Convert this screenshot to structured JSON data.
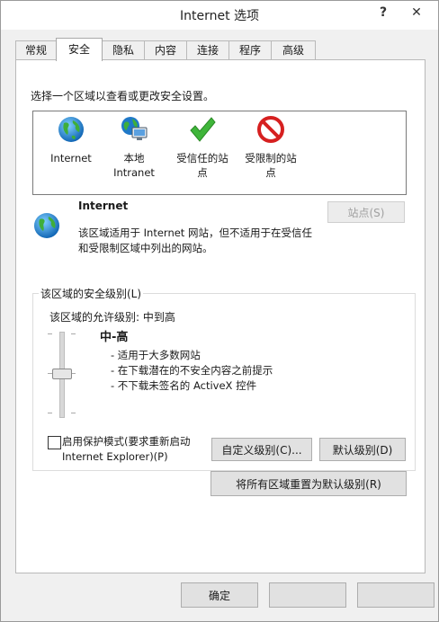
{
  "window": {
    "title": "Internet 选项",
    "help_glyph": "?",
    "close_glyph": "✕"
  },
  "tabs": [
    {
      "label": "常规"
    },
    {
      "label": "安全"
    },
    {
      "label": "隐私"
    },
    {
      "label": "内容"
    },
    {
      "label": "连接"
    },
    {
      "label": "程序"
    },
    {
      "label": "高级"
    }
  ],
  "security": {
    "select_prompt": "选择一个区域以查看或更改安全设置。",
    "zones": [
      {
        "label_line1": "Internet",
        "label_line2": "",
        "icon": "globe-icon"
      },
      {
        "label_line1": "本地",
        "label_line2": "Intranet",
        "icon": "intranet-icon"
      },
      {
        "label_line1": "受信任的站",
        "label_line2": "点",
        "icon": "check-icon"
      },
      {
        "label_line1": "受限制的站",
        "label_line2": "点",
        "icon": "restricted-icon"
      }
    ],
    "selected_zone": {
      "name": "Internet",
      "desc_line1": "该区域适用于 Internet 网站，但不适用于在受信任",
      "desc_line2": "和受限制区域中列出的网站。"
    },
    "sites_button": "站点(S)",
    "level_group": {
      "label": "该区域的安全级别(L)",
      "allowed": "该区域的允许级别: 中到高",
      "level_name": "中-高",
      "bullets": [
        "- 适用于大多数网站",
        "- 在下载潜在的不安全内容之前提示",
        "- 不下载未签名的 ActiveX 控件"
      ],
      "slider_level_index": 1,
      "slider_levels": 3,
      "protected_mode_line1": "启用保护模式(要求重新启动",
      "protected_mode_line2": "Internet Explorer)(P)",
      "protected_mode_checked": false,
      "custom_level_button": "自定义级别(C)...",
      "default_level_button": "默认级别(D)"
    },
    "reset_all_button": "将所有区域重置为默认级别(R)"
  },
  "footer": {
    "ok_button": "确定",
    "cancel_button": "",
    "apply_button": ""
  }
}
